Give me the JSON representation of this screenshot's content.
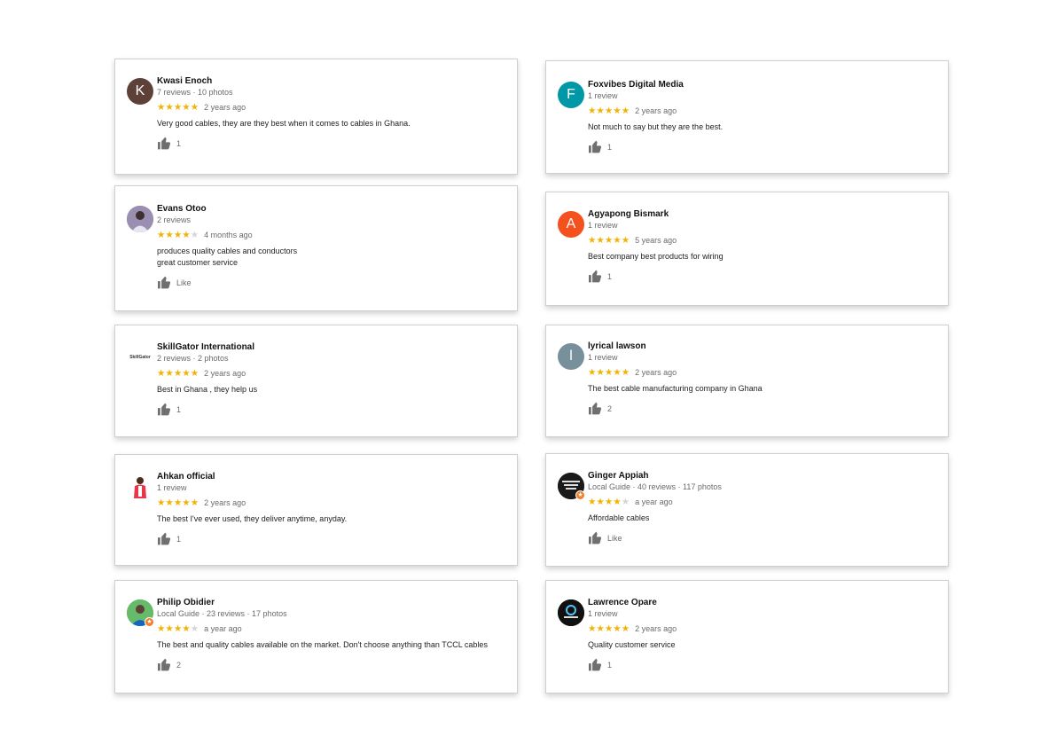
{
  "reviews": [
    {
      "name": "Kwasi Enoch",
      "meta": "7 reviews · 10 photos",
      "stars": 5,
      "ago": "2 years ago",
      "text": [
        "Very good cables, they are they best when it comes to cables in Ghana."
      ],
      "likes": "1",
      "avatar_letter": "K",
      "avatar_color": "#5d4037",
      "avatar_type": "letter"
    },
    {
      "name": "Foxvibes Digital Media",
      "meta": "1 review",
      "stars": 5,
      "ago": "2 years ago",
      "text": [
        "Not much to say but they are the best."
      ],
      "likes": "1",
      "avatar_letter": "F",
      "avatar_color": "#0097a7",
      "avatar_type": "letter"
    },
    {
      "name": "Evans Otoo",
      "meta": "2 reviews",
      "stars": 4,
      "ago": "4 months ago",
      "text": [
        "produces quality cables and conductors",
        "great customer service"
      ],
      "likes": "Like",
      "avatar_color": "#7b6f8e",
      "avatar_type": "photo"
    },
    {
      "name": "Agyapong Bismark",
      "meta": "1 review",
      "stars": 5,
      "ago": "5 years ago",
      "text": [
        "Best company best products for wiring"
      ],
      "likes": "1",
      "avatar_letter": "A",
      "avatar_color": "#f4511e",
      "avatar_type": "letter"
    },
    {
      "name": "SkillGator International",
      "meta": "2 reviews · 2 photos",
      "stars": 5,
      "ago": "2 years ago",
      "text": [
        "Best in Ghana , they help us"
      ],
      "likes": "1",
      "avatar_color": "#ffffff",
      "avatar_type": "logo",
      "logo_text": "SkillGator"
    },
    {
      "name": "lyrical lawson",
      "meta": "1 review",
      "stars": 5,
      "ago": "2 years ago",
      "text": [
        "The best cable manufacturing company in Ghana"
      ],
      "likes": "2",
      "avatar_letter": "l",
      "avatar_color": "#78909c",
      "avatar_type": "letter"
    },
    {
      "name": "Ahkan official",
      "meta": "1 review",
      "stars": 5,
      "ago": "2 years ago",
      "text": [
        "The best I've ever used, they deliver anytime, anyday."
      ],
      "likes": "1",
      "avatar_color": "#ffffff",
      "avatar_type": "person"
    },
    {
      "name": "Ginger Appiah",
      "meta": "Local Guide · 40 reviews · 117 photos",
      "stars": 4,
      "ago": "a year ago",
      "text": [
        "Affordable cables"
      ],
      "likes": "Like",
      "avatar_color": "#1a1a1a",
      "avatar_type": "dark",
      "guide": true
    },
    {
      "name": "Philip Obidier",
      "meta": "Local Guide · 23 reviews · 17 photos",
      "stars": 4,
      "ago": "a year ago",
      "text": [
        "The best and quality cables available on the market. Don't choose anything than TCCL cables"
      ],
      "likes": "2",
      "avatar_color": "#4caf50",
      "avatar_type": "photo2",
      "guide": true
    },
    {
      "name": "Lawrence Opare",
      "meta": "1 review",
      "stars": 5,
      "ago": "2 years ago",
      "text": [
        "Quality customer service"
      ],
      "likes": "1",
      "avatar_color": "#111111",
      "avatar_type": "dark2"
    }
  ]
}
